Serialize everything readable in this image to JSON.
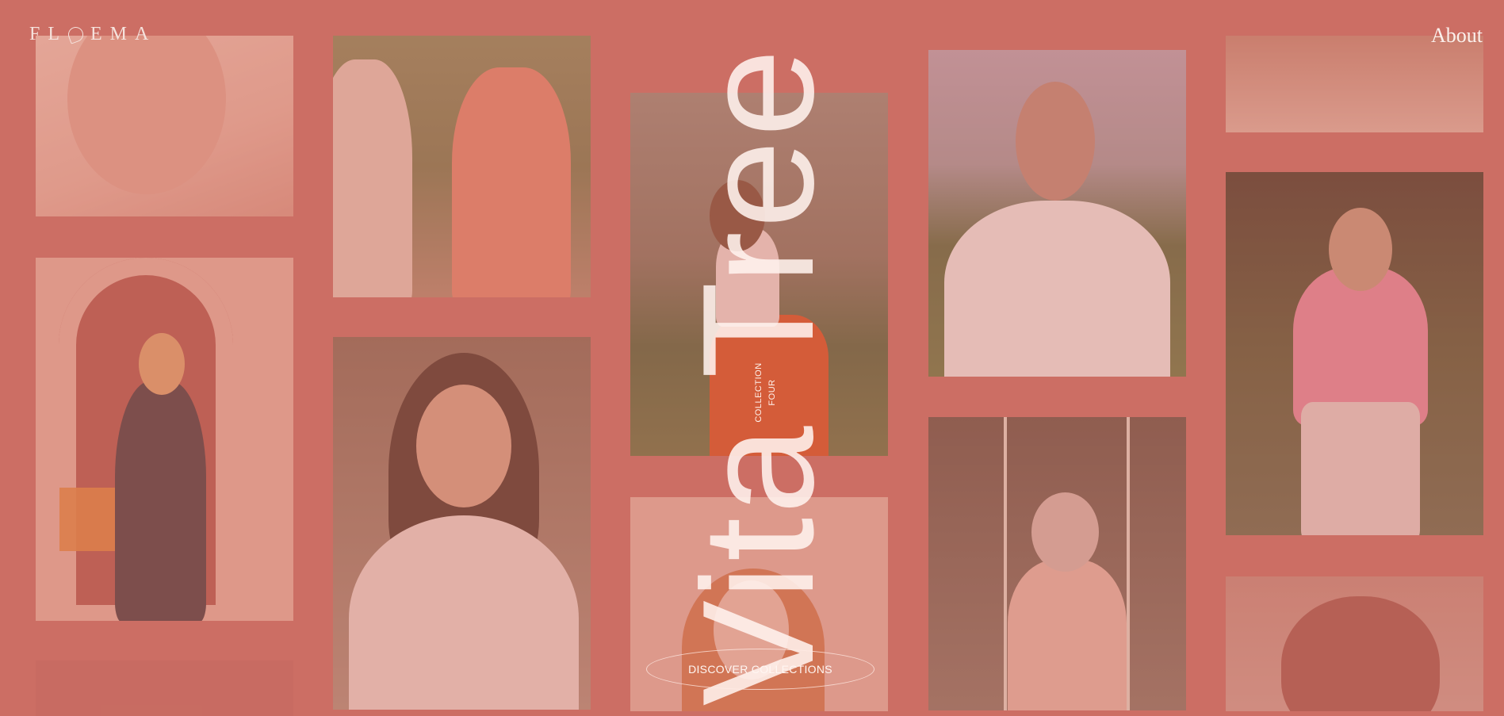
{
  "brand": {
    "logo_text": "FLOEMA",
    "logo_letters_before": "FL",
    "logo_letters_after": "EMA",
    "logo_mark_icon": "flower-icon"
  },
  "nav": {
    "about_label": "About"
  },
  "hero": {
    "title": "Vita Tree",
    "collection_line1": "COLLECTION",
    "collection_line2": "FOUR",
    "cta_label": "DISCOVER COLLECTIONS"
  },
  "colors": {
    "background": "#cc6e64",
    "text": "#f5e2dc"
  },
  "gallery": {
    "images": [
      "shoulder-closeup-photo",
      "woman-in-arch-photo",
      "woman-in-dress-photo",
      "woman-portrait-photo",
      "woman-orange-skirt-photo",
      "red-haired-woman-photo",
      "woman-white-tee-photo",
      "elderly-woman-swing-photo",
      "woman-pink-shirt-photo"
    ]
  }
}
